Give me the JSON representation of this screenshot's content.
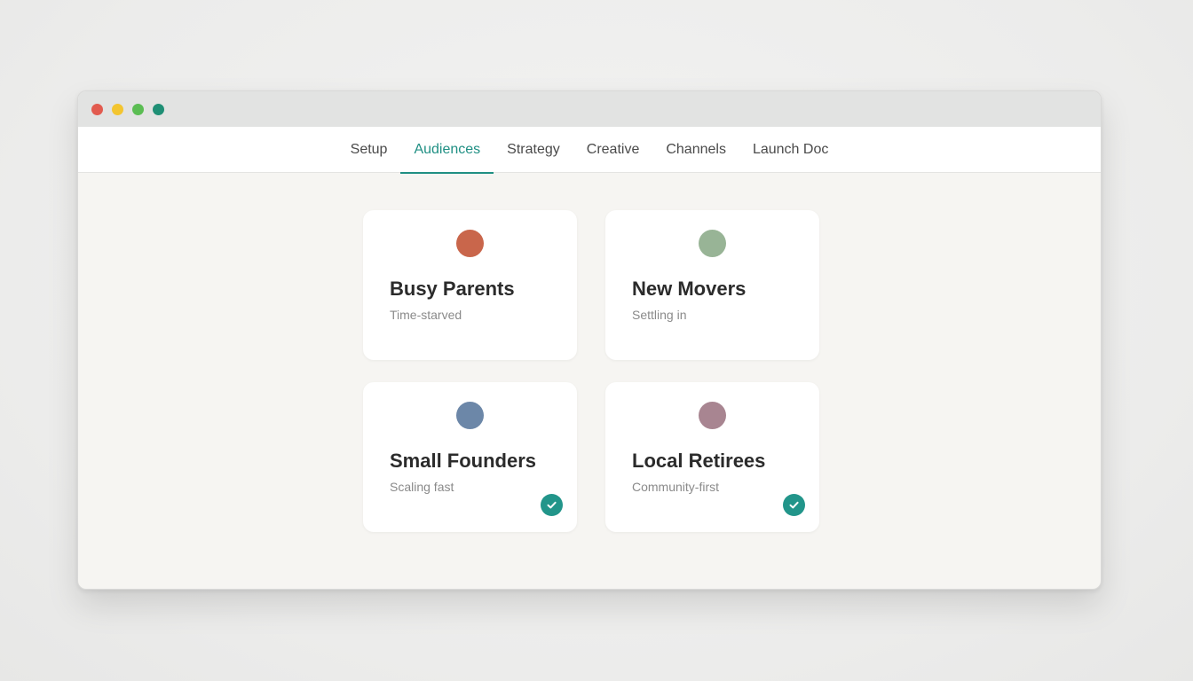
{
  "window": {
    "traffic_lights": [
      {
        "name": "close",
        "color": "#e25b4f"
      },
      {
        "name": "minimize",
        "color": "#f3c530"
      },
      {
        "name": "maximize",
        "color": "#5bbd53"
      },
      {
        "name": "extra",
        "color": "#1f8f75"
      }
    ]
  },
  "nav": {
    "tabs": [
      {
        "label": "Setup",
        "active": false
      },
      {
        "label": "Audiences",
        "active": true
      },
      {
        "label": "Strategy",
        "active": false
      },
      {
        "label": "Creative",
        "active": false
      },
      {
        "label": "Channels",
        "active": false
      },
      {
        "label": "Launch Doc",
        "active": false
      }
    ],
    "accent_color": "#1f8f83"
  },
  "audiences": [
    {
      "title": "Busy Parents",
      "subtitle": "Time-starved",
      "color": "#c9664b",
      "selected": false
    },
    {
      "title": "New Movers",
      "subtitle": "Settling in",
      "color": "#98b496",
      "selected": false
    },
    {
      "title": "Small Founders",
      "subtitle": "Scaling fast",
      "color": "#6c87a8",
      "selected": true
    },
    {
      "title": "Local Retirees",
      "subtitle": "Community-first",
      "color": "#a88591",
      "selected": true
    }
  ],
  "icons": {
    "selected": "check-icon"
  }
}
